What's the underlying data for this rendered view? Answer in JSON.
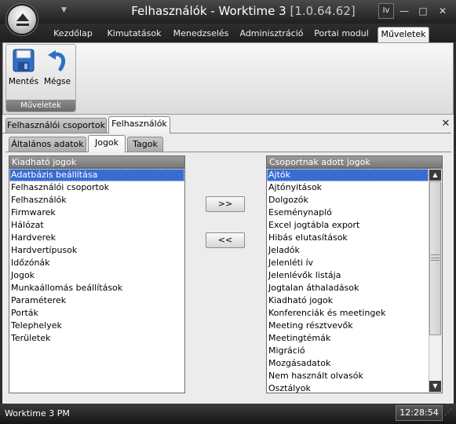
{
  "window": {
    "title": "Felhasználók - ",
    "app_name": "Worktime 3 ",
    "version": "[1.0.64.62]",
    "lang_button": "Iv",
    "controls": {
      "minimize": "—",
      "maximize": "□",
      "close": "✕"
    }
  },
  "ribbon": {
    "tabs": [
      "Kezdőlap",
      "Kimutatások",
      "Menedzselés",
      "Adminisztráció",
      "Portai modul",
      "Műveletek"
    ],
    "active_tab": "Műveletek",
    "group_label": "Műveletek",
    "buttons": {
      "save": "Mentés",
      "cancel": "Mégse"
    }
  },
  "doc_tabs": [
    "Felhasználói csoportok",
    "Felhasználók"
  ],
  "sub_tabs": [
    "Általános adatok",
    "Jogok",
    "Tagok"
  ],
  "left_list": {
    "header": "Kiadható jogok",
    "items": [
      "Adatbázis beállítása",
      "Felhasználói csoportok",
      "Felhasználók",
      "Firmwarek",
      "Hálózat",
      "Hardverek",
      "Hardvertípusok",
      "Időzónák",
      "Jogok",
      "Munkaállomás beállítások",
      "Paraméterek",
      "Porták",
      "Telephelyek",
      "Területek"
    ],
    "selected_index": 0
  },
  "right_list": {
    "header": "Csoportnak adott jogok",
    "items": [
      "Ajtók",
      "Ajtónyitások",
      "Dolgozók",
      "Eseménynapló",
      "Excel jogtábla export",
      "Hibás elutasítások",
      "Jeladók",
      "Jelenléti ív",
      "Jelenlévők listája",
      "Jogtalan áthaladások",
      "Kiadható jogok",
      "Konferenciák és meetingek",
      "Meeting résztvevők",
      "Meetingtémák",
      "Migráció",
      "Mozgásadatok",
      "Nem használt olvasók",
      "Osztályok"
    ],
    "selected_index": 0
  },
  "move_buttons": {
    "add": ">>",
    "remove": "<<"
  },
  "status": {
    "text": "Worktime 3 PM",
    "clock": "12:28:54"
  },
  "colors": {
    "selection": "#3a6cd0",
    "chrome_dark": "#1e1e1e"
  }
}
